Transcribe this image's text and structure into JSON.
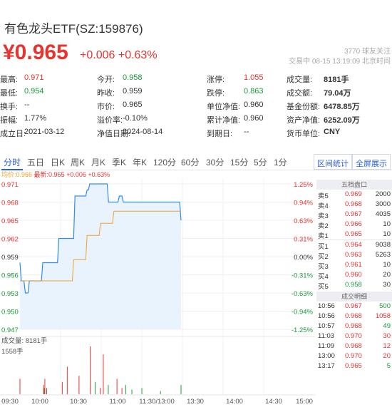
{
  "header": {
    "title": "有色龙头ETF(SZ:159876)",
    "price": "¥0.965",
    "change": "+0.006",
    "change_pct": "+0.63%",
    "follow_count": "3770",
    "follow_label": "球友关注",
    "status": "交易中 08-15 13:19:09 北京时间"
  },
  "quote": [
    [
      {
        "label": "最高:",
        "value": "0.971",
        "color": "red"
      },
      {
        "label": "今开:",
        "value": "0.958",
        "color": "green"
      },
      {
        "label": "涨停:",
        "value": "1.055",
        "color": "red"
      },
      {
        "label": "成交量:",
        "value": "8181手",
        "color": "dark"
      }
    ],
    [
      {
        "label": "最低:",
        "value": "0.954",
        "color": "green"
      },
      {
        "label": "昨收:",
        "value": "0.959",
        "color": "dark"
      },
      {
        "label": "跌停:",
        "value": "0.863",
        "color": "green"
      },
      {
        "label": "成交额:",
        "value": "79.04万",
        "color": "dark"
      }
    ],
    [
      {
        "label": "换手:",
        "value": "--",
        "color": "dark"
      },
      {
        "label": "市价:",
        "value": "0.965",
        "color": "dark"
      },
      {
        "label": "单位净值:",
        "value": "0.960",
        "color": "dark"
      },
      {
        "label": "基金份额:",
        "value": "6478.85万",
        "color": "dark"
      }
    ],
    [
      {
        "label": "振幅:",
        "value": "1.77%",
        "color": "dark"
      },
      {
        "label": "溢价率:",
        "value": "-0.10%",
        "color": "dark"
      },
      {
        "label": "累计净值:",
        "value": "0.960",
        "color": "dark"
      },
      {
        "label": "资产净值:",
        "value": "6252.09万",
        "color": "dark"
      }
    ],
    [
      {
        "label": "成立日:",
        "value": "2021-03-12",
        "color": "dark"
      },
      {
        "label": "净值日期:",
        "value": "2024-08-14",
        "color": "dark"
      },
      {
        "label": "到期日:",
        "value": "--",
        "color": "dark"
      },
      {
        "label": "货币单位:",
        "value": "CNY",
        "color": "dark"
      }
    ]
  ],
  "tabs": [
    "分时",
    "五日",
    "日K",
    "周K",
    "月K",
    "季K",
    "年K",
    "120分",
    "60分",
    "30分",
    "15分",
    "5分",
    "1分"
  ],
  "active_tab": "分时",
  "buttons": {
    "interval_stats": "区间统计",
    "fullscreen": "全屏展示"
  },
  "legend": {
    "avg": "均价:0.966",
    "latest": "最新:0.965 +0.006 +0.63%"
  },
  "chart_data": {
    "type": "line",
    "price_ticks": [
      "0.971",
      "0.968",
      "0.965",
      "0.962",
      "0.959",
      "0.956",
      "0.953",
      "0.950",
      "0.947"
    ],
    "pct_ticks": [
      "1.25%",
      "0.94%",
      "0.63%",
      "0.31%",
      "0.00%",
      "-0.31%",
      "-0.63%",
      "-0.94%",
      "-1.25%"
    ],
    "time_labels": [
      "09:30",
      "10:00",
      "10:30",
      "11:00",
      "11:30/13:00",
      "13:30",
      "14:00",
      "14:30",
      "15:00"
    ],
    "ylim": [
      0.947,
      0.971
    ],
    "prev_close": 0.959,
    "price_series": [
      0.958,
      0.955,
      0.955,
      0.955,
      0.953,
      0.953,
      0.953,
      0.955,
      0.955,
      0.955,
      0.955,
      0.955,
      0.955,
      0.955,
      0.955,
      0.955,
      0.955,
      0.958,
      0.958,
      0.958,
      0.958,
      0.958,
      0.958,
      0.958,
      0.958,
      0.958,
      0.958,
      0.958,
      0.958,
      0.962,
      0.962,
      0.962,
      0.962,
      0.962,
      0.962,
      0.962,
      0.962,
      0.962,
      0.962,
      0.962,
      0.962,
      0.969,
      0.969,
      0.969,
      0.969,
      0.969,
      0.969,
      0.969,
      0.969,
      0.969,
      0.97,
      0.97,
      0.971,
      0.971,
      0.971,
      0.971,
      0.971,
      0.971,
      0.971,
      0.971,
      0.971,
      0.971,
      0.971,
      0.971,
      0.971,
      0.971,
      0.968,
      0.968,
      0.968,
      0.968,
      0.968,
      0.968,
      0.968,
      0.968,
      0.969,
      0.969,
      0.969,
      0.968,
      0.968,
      0.968,
      0.968,
      0.968,
      0.968,
      0.968,
      0.968,
      0.968,
      0.968,
      0.968,
      0.968,
      0.968,
      0.968,
      0.968,
      0.968,
      0.968,
      0.968,
      0.968,
      0.968,
      0.968,
      0.968,
      0.968,
      0.968,
      0.968,
      0.968,
      0.968,
      0.968,
      0.968,
      0.968,
      0.968,
      0.968,
      0.968,
      0.968,
      0.968,
      0.968,
      0.968,
      0.968,
      0.968,
      0.968,
      0.968,
      0.968,
      0.968,
      0.965
    ],
    "avg_series": [
      0.955,
      0.955,
      0.955,
      0.955,
      0.955,
      0.955,
      0.955,
      0.955,
      0.955,
      0.955,
      0.955,
      0.955,
      0.955,
      0.955,
      0.955,
      0.955,
      0.955,
      0.955,
      0.955,
      0.955,
      0.955,
      0.955,
      0.955,
      0.955,
      0.955,
      0.955,
      0.955,
      0.955,
      0.955,
      0.955,
      0.955,
      0.955,
      0.955,
      0.955,
      0.955,
      0.955,
      0.955,
      0.955,
      0.955,
      0.955,
      0.9585,
      0.9585,
      0.9585,
      0.9585,
      0.9585,
      0.9585,
      0.9585,
      0.9585,
      0.9585,
      0.9585,
      0.9625,
      0.9625,
      0.9625,
      0.9625,
      0.9625,
      0.9625,
      0.9625,
      0.9625,
      0.9625,
      0.9625,
      0.9645,
      0.9645,
      0.9645,
      0.9645,
      0.9645,
      0.9645,
      0.9645,
      0.9645,
      0.9645,
      0.9645,
      0.9665,
      0.9665,
      0.9665,
      0.9665,
      0.9665,
      0.9665,
      0.9665,
      0.9665,
      0.9665,
      0.9665,
      0.9665,
      0.9665,
      0.9665,
      0.9665,
      0.9665,
      0.9665,
      0.9665,
      0.9665,
      0.9665,
      0.9665,
      0.9665,
      0.9665,
      0.9665,
      0.9665,
      0.9665,
      0.9665,
      0.9665,
      0.9665,
      0.9665,
      0.9665,
      0.9665,
      0.9665,
      0.9665,
      0.9665,
      0.9665,
      0.9665,
      0.9665,
      0.9665,
      0.9665,
      0.9665,
      0.9665,
      0.9665,
      0.9665,
      0.9665,
      0.9665,
      0.9665,
      0.9665,
      0.9665,
      0.9665,
      0.9665,
      0.9665
    ],
    "volume_label": "成交量: 8181手",
    "volume_max_label": "1558手",
    "volume_max": 1558,
    "volume_series": [
      500,
      0,
      0,
      0,
      0,
      0,
      0,
      0,
      0,
      0,
      0,
      0,
      0,
      0,
      0,
      0,
      0,
      0,
      0,
      0,
      0,
      0,
      0,
      0,
      0,
      0,
      0,
      0,
      0,
      0,
      0,
      0,
      0,
      0,
      0,
      0,
      0,
      0,
      300,
      200,
      500,
      0,
      0,
      200,
      0,
      0,
      0,
      0,
      0,
      0,
      0,
      0,
      0,
      0,
      0,
      0,
      0,
      0,
      0,
      0,
      0,
      0,
      0,
      0,
      0,
      0,
      0,
      0,
      400,
      0,
      0,
      0,
      0,
      0,
      0,
      0,
      900,
      0,
      0,
      0,
      0,
      0,
      0,
      0,
      0,
      0,
      0,
      0,
      0,
      0,
      0,
      0,
      0,
      0,
      0,
      600,
      0,
      0,
      0,
      0,
      0,
      0,
      0,
      0,
      0,
      0,
      0,
      0,
      0,
      0,
      0,
      0,
      0,
      1558,
      0,
      0,
      0,
      0,
      0,
      0,
      0,
      400,
      0,
      0,
      0,
      0,
      0,
      0,
      0,
      200,
      0,
      0,
      0,
      0,
      1300,
      0,
      0,
      0,
      0,
      0,
      0,
      0,
      300,
      0,
      0,
      0,
      0,
      0,
      0,
      0,
      0,
      0,
      0,
      0,
      0,
      0,
      500,
      0,
      0,
      0,
      0,
      0,
      0,
      0,
      200,
      0,
      0,
      0,
      0,
      0,
      300,
      0,
      0,
      0,
      0,
      0,
      0,
      0,
      0,
      0,
      150,
      0,
      0,
      0,
      0,
      0,
      0,
      0,
      0,
      0,
      0,
      0,
      0,
      0,
      0,
      0,
      200,
      0,
      0,
      0,
      0,
      0,
      0,
      0,
      0,
      0,
      0,
      0,
      0,
      0,
      0,
      0,
      0,
      0,
      0,
      0,
      0,
      0,
      0,
      0,
      0,
      0,
      0,
      0,
      0,
      0,
      100,
      0,
      0,
      0,
      0,
      0,
      0,
      0,
      0,
      0,
      0,
      0,
      0,
      0,
      0,
      0,
      0,
      0,
      0,
      0,
      0,
      0,
      0,
      0,
      0,
      0,
      0,
      0,
      0,
      0,
      0,
      0,
      0,
      300
    ],
    "volume_up": [
      true,
      false,
      false,
      false,
      false,
      false,
      false,
      false,
      false,
      false,
      false,
      false,
      false,
      false,
      false,
      false,
      false,
      false,
      false,
      false,
      false,
      false,
      false,
      false,
      false,
      false,
      false,
      false,
      false,
      false,
      false,
      false,
      false,
      false,
      false,
      false,
      false,
      false,
      true,
      false,
      true,
      false,
      false,
      true,
      false,
      false,
      false,
      false,
      false,
      false,
      false,
      false,
      false,
      false,
      false,
      false,
      false,
      false,
      false,
      false,
      false,
      false,
      false,
      false,
      false,
      false,
      false,
      false,
      true,
      false,
      false,
      false,
      false,
      false,
      false,
      false,
      true,
      false,
      false,
      false,
      false,
      false,
      false,
      false,
      false,
      false,
      false,
      false,
      false,
      false,
      false,
      false,
      false,
      false,
      false,
      true,
      false,
      false,
      false,
      false,
      false,
      false,
      false,
      false,
      false,
      false,
      false,
      false,
      false,
      false,
      false,
      false,
      false,
      true,
      false,
      false,
      false,
      false,
      false,
      false,
      false,
      false,
      false,
      false,
      false,
      false,
      false,
      false,
      false,
      true,
      false,
      false,
      false,
      false,
      true,
      false,
      false,
      false,
      false,
      false,
      false,
      false,
      false,
      false,
      false,
      false,
      false,
      false,
      false,
      false,
      false,
      false,
      false,
      false,
      false,
      false,
      true,
      false,
      false,
      false,
      false,
      false,
      false,
      false,
      true,
      false,
      false,
      false,
      false,
      false,
      false,
      false,
      false,
      false,
      false,
      false,
      false,
      false,
      false,
      false,
      false,
      false,
      false,
      false,
      false,
      false,
      false,
      false,
      false,
      false,
      false,
      false,
      false,
      false,
      false,
      false,
      false,
      false,
      false,
      false,
      false,
      false,
      false,
      false,
      false,
      false,
      false,
      false,
      false,
      false,
      false,
      false,
      false,
      false,
      false,
      false,
      false,
      false,
      false,
      false,
      false,
      false,
      false,
      false,
      false,
      false,
      false,
      false,
      false,
      false,
      false,
      false,
      false,
      false,
      false,
      false,
      false,
      false,
      false,
      false,
      false,
      false,
      false,
      false,
      false,
      false,
      false,
      false,
      false,
      false,
      false,
      false,
      false,
      false,
      false,
      false,
      false,
      false,
      false,
      false,
      false,
      false,
      false
    ]
  },
  "order_book": {
    "title": "五档盘口",
    "rows": [
      {
        "label": "卖5",
        "price": "0.969",
        "vol": "2000",
        "color": "red"
      },
      {
        "label": "卖4",
        "price": "0.968",
        "vol": "3000",
        "color": "red"
      },
      {
        "label": "卖3",
        "price": "0.967",
        "vol": "4035",
        "color": "red"
      },
      {
        "label": "卖2",
        "price": "0.966",
        "vol": "10",
        "color": "red"
      },
      {
        "label": "卖1",
        "price": "0.965",
        "vol": "10",
        "color": "red"
      },
      {
        "label": "买1",
        "price": "0.964",
        "vol": "9038",
        "color": "red"
      },
      {
        "label": "买2",
        "price": "0.963",
        "vol": "5263",
        "color": "red"
      },
      {
        "label": "买3",
        "price": "0.961",
        "vol": "10",
        "color": "red"
      },
      {
        "label": "买4",
        "price": "0.960",
        "vol": "20",
        "color": "red"
      },
      {
        "label": "买5",
        "price": "0.958",
        "vol": "30",
        "color": "green"
      }
    ]
  },
  "trades": {
    "title": "成交明细",
    "rows": [
      {
        "time": "10:56",
        "price": "0.967",
        "vol": "500",
        "vcolor": "green"
      },
      {
        "time": "10:56",
        "price": "0.968",
        "vol": "1058",
        "vcolor": "red"
      },
      {
        "time": "10:57",
        "price": "0.968",
        "vol": "49",
        "vcolor": "green"
      },
      {
        "time": "11:03",
        "price": "0.970",
        "vol": "30",
        "vcolor": "red"
      },
      {
        "time": "11:09",
        "price": "0.968",
        "vol": "12",
        "vcolor": "red"
      },
      {
        "time": "13:00",
        "price": "0.970",
        "vol": "20",
        "vcolor": "red"
      },
      {
        "time": "13:17",
        "price": "0.965",
        "vol": "5",
        "vcolor": "green"
      }
    ]
  }
}
